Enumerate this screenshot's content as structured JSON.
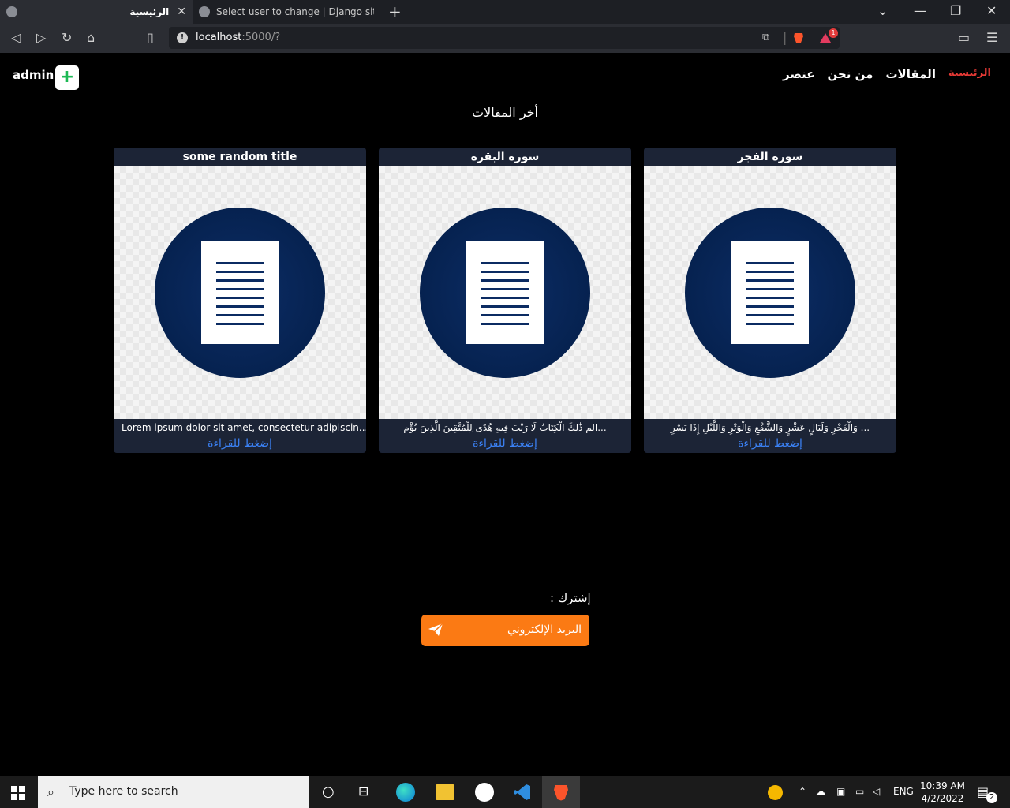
{
  "browser": {
    "tabs": [
      {
        "title": "الرئيسية",
        "active": true
      },
      {
        "title": "Select user to change | Django site ad",
        "active": false
      }
    ],
    "url_host": "localhost",
    "url_rest": ":5000/?",
    "shield_badge": "1"
  },
  "nav": {
    "items": [
      {
        "label": "الرئيسية",
        "active": true
      },
      {
        "label": "المقالات",
        "active": false
      },
      {
        "label": "من نحن",
        "active": false
      },
      {
        "label": "عنصر",
        "active": false
      }
    ],
    "user": "admin",
    "plus_label": "+"
  },
  "section_title": "أخر المقالات",
  "cards": [
    {
      "title": "some random title",
      "excerpt": "Lorem ipsum dolor sit amet, consectetur adipiscin...",
      "more": "إضغط للقراءة"
    },
    {
      "title": "سورة البقرة",
      "excerpt": "...الم ذَٰلِكَ الْكِتَابُ لَا رَيْبَ فِيهِ هُدًى لِلْمُتَّقِينَ الَّذِينَ يُؤْم",
      "more": "إضغط للقراءة"
    },
    {
      "title": "سورة الفجر",
      "excerpt": "... وَالْفَجْرِ وَلَيَالٍ عَشْرٍ وَالشَّفْعِ وَالْوَتْرِ وَاللَّيْلِ إِذَا يَسْرِ",
      "more": "إضغط للقراءة"
    }
  ],
  "subscribe": {
    "label": "إشترك :",
    "button": "البريد الإلكتروني"
  },
  "taskbar": {
    "search_placeholder": "Type here to search",
    "lang": "ENG",
    "time": "10:39 AM",
    "date": "4/2/2022",
    "notifications": "2"
  },
  "colors": {
    "nav_active": "#e53935",
    "link": "#3b82f6",
    "subscribe_button": "#fb7a14",
    "card_bg": "#1c2436"
  }
}
